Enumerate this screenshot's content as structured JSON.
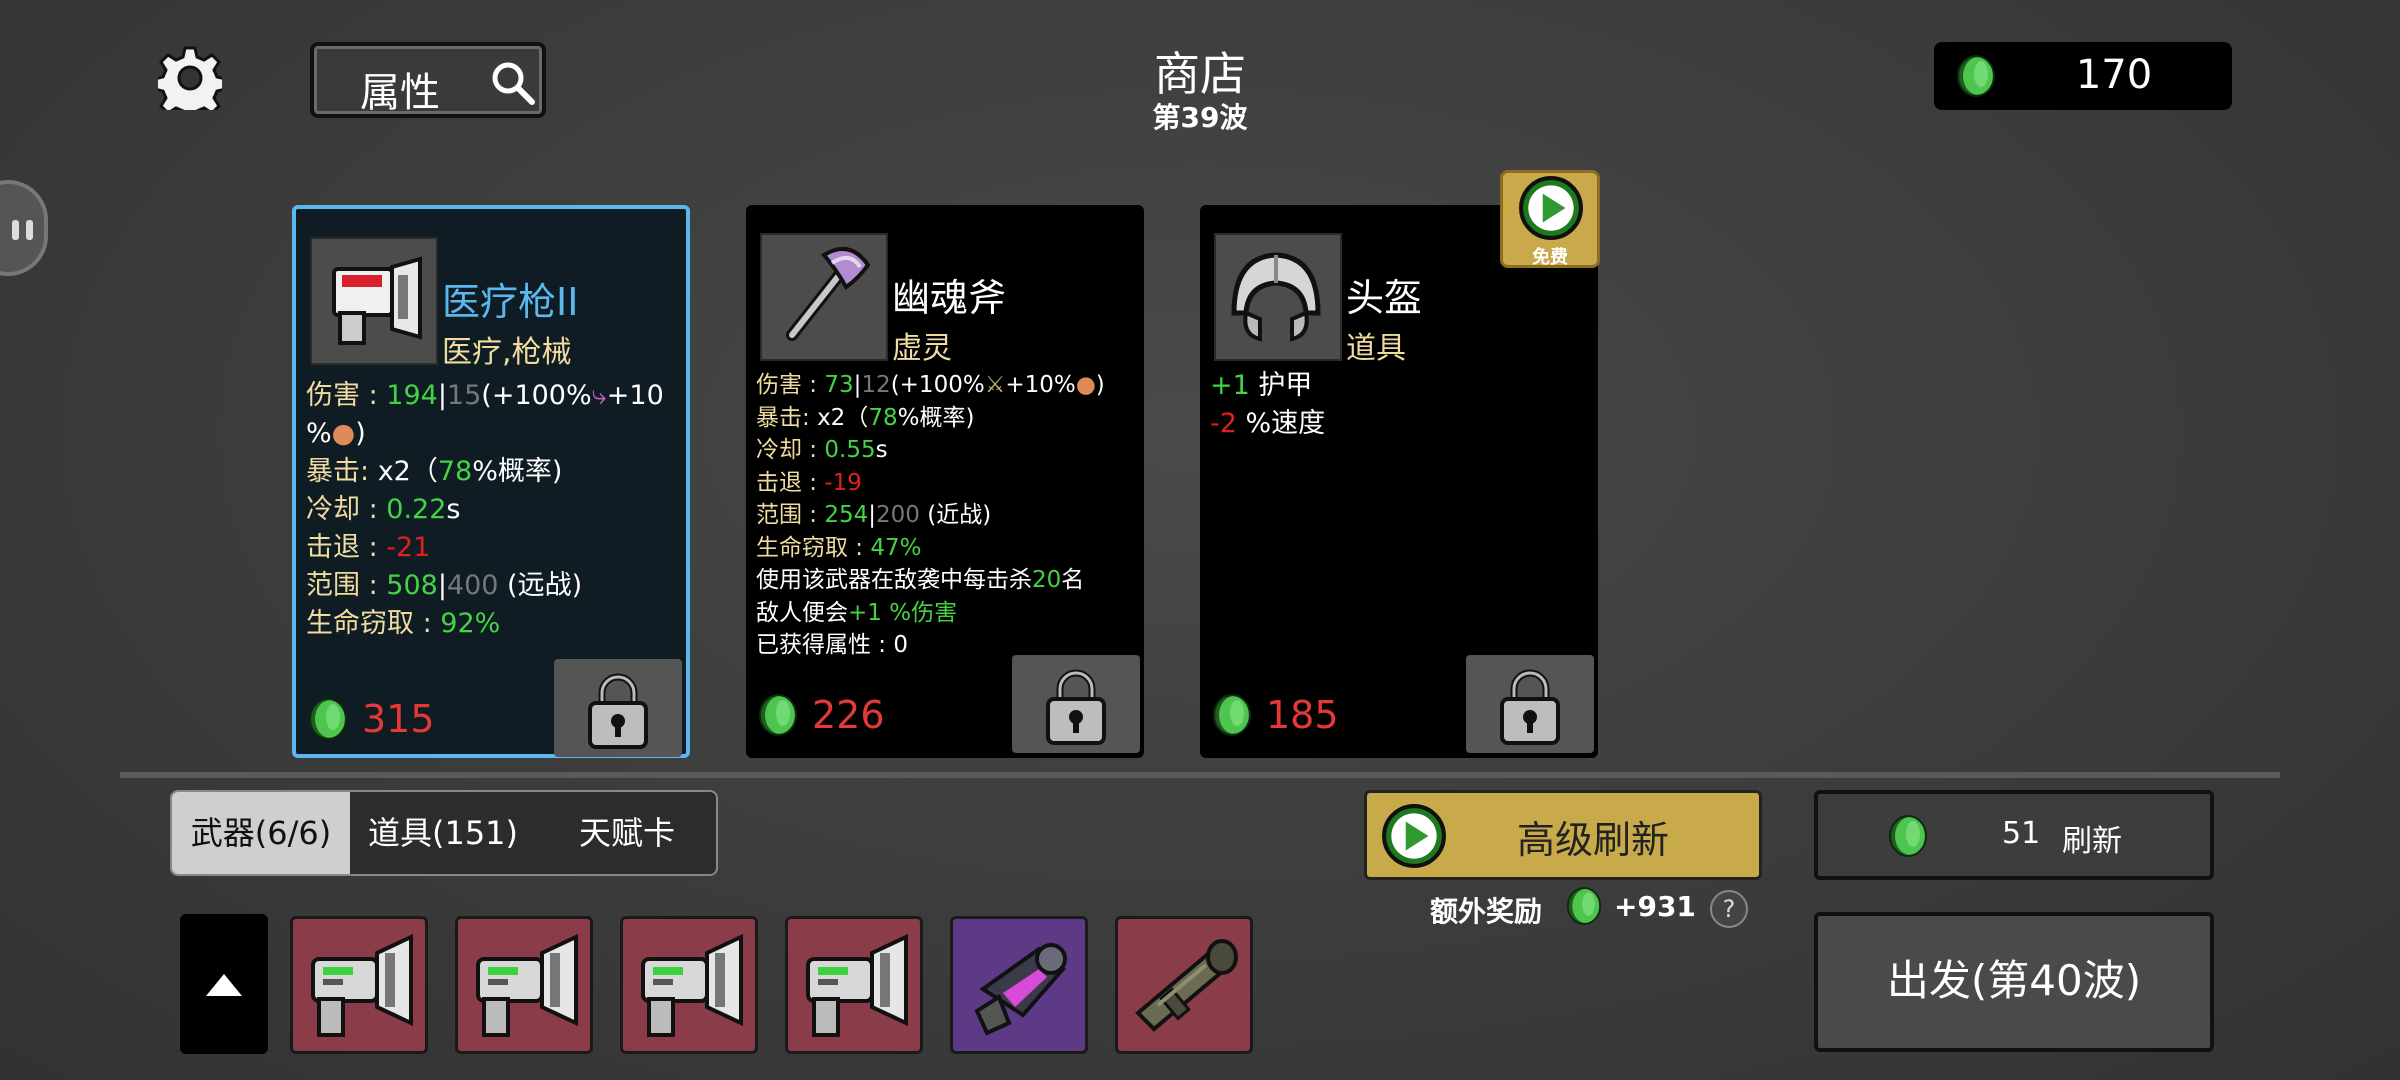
{
  "header": {
    "search_label": "属性",
    "title": "商店",
    "wave": "第39波",
    "gold": "170"
  },
  "cards": [
    {
      "name": "医疗枪II",
      "type": "医疗,枪械",
      "name_color": "#5ab8ee",
      "price": "315",
      "stats": {
        "damage_key": "伤害 : ",
        "damage_val": "194",
        "damage_sep": "|",
        "damage_base": "15",
        "damage_rest_a": "(+100%",
        "damage_rest_b": "+10",
        "damage_rest_c": "%",
        "damage_rest_d": ")",
        "crit_key": "暴击: ",
        "crit_a": "x2（",
        "crit_b": "78",
        "crit_c": "%概率)",
        "cd_key": "冷却 : ",
        "cd_val": "0.22",
        "cd_unit": "s",
        "kb_key": "击退 : ",
        "kb_val": "-21",
        "range_key": "范围 : ",
        "range_val": "508",
        "range_sep": "|",
        "range_base": "400",
        "range_note": " (远战)",
        "ls_key": "生命窃取 : ",
        "ls_val": "92%"
      }
    },
    {
      "name": "幽魂斧",
      "type": "虚灵",
      "price": "226",
      "stats": {
        "damage_key": "伤害 : ",
        "damage_val": "73",
        "damage_sep": "|",
        "damage_base": "12",
        "damage_rest_a": "(+100%",
        "damage_rest_b": "+10%",
        "damage_rest_c": ")",
        "crit_key": "暴击: ",
        "crit_a": "x2（",
        "crit_b": "78",
        "crit_c": "%概率)",
        "cd_key": "冷却 : ",
        "cd_val": "0.55",
        "cd_unit": "s",
        "kb_key": "击退 : ",
        "kb_val": "-19",
        "range_key": "范围 : ",
        "range_val": "254",
        "range_sep": "|",
        "range_base": "200",
        "range_note": " (近战)",
        "ls_key": "生命窃取 : ",
        "ls_val": "47%",
        "effect_a": "使用该武器在敌袭中每击杀",
        "effect_b": "20",
        "effect_c": "名",
        "effect_d": "敌人便会",
        "effect_e": "+1 %伤害",
        "gained_key": "已获得属性 : ",
        "gained_val": "0"
      }
    },
    {
      "name": "头盔",
      "type": "道具",
      "price": "185",
      "stats": {
        "armor_val": "+1",
        "armor_key": " 护甲",
        "speed_val": "-2",
        "speed_key": " %速度"
      },
      "free_label": "免费"
    }
  ],
  "tabs": [
    {
      "label": "武器(6/6)",
      "active": true
    },
    {
      "label": "道具(151)",
      "active": false
    },
    {
      "label": "天赋卡",
      "active": false
    }
  ],
  "inventory": [
    {
      "item": "medical-gun",
      "color": "red"
    },
    {
      "item": "medical-gun",
      "color": "red"
    },
    {
      "item": "medical-gun",
      "color": "red"
    },
    {
      "item": "medical-gun",
      "color": "red"
    },
    {
      "item": "purple-blaster",
      "color": "purple"
    },
    {
      "item": "rocket-launcher",
      "color": "red"
    }
  ],
  "actions": {
    "advanced_refresh": "高级刷新",
    "bonus_label": "额外奖励",
    "bonus_value": "+931",
    "help": "?",
    "refresh_cost": "51",
    "refresh_label": "刷新",
    "go_label": "出发(第40波)"
  }
}
